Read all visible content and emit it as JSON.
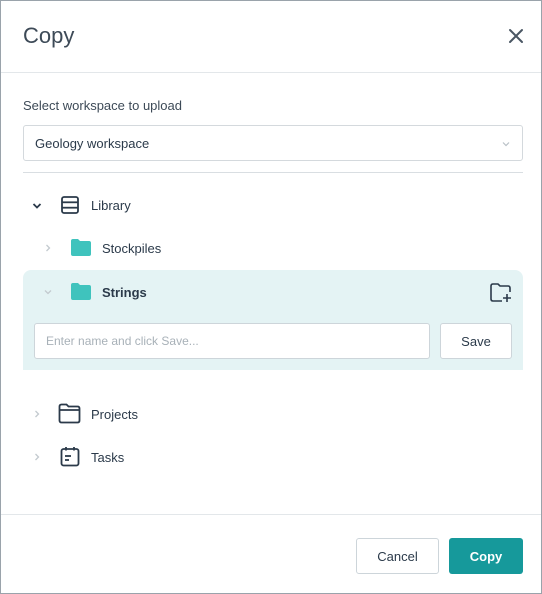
{
  "dialog": {
    "title": "Copy",
    "close_icon": "close-icon"
  },
  "workspace": {
    "label": "Select workspace to upload",
    "selected": "Geology workspace",
    "chevron_icon": "chevron-down-icon"
  },
  "tree": {
    "library": {
      "label": "Library",
      "icon": "library-icon",
      "expanded": true
    },
    "stockpiles": {
      "label": "Stockpiles",
      "icon": "folder-icon",
      "expanded": false
    },
    "strings": {
      "label": "Strings",
      "icon": "folder-icon",
      "selected": true
    },
    "projects": {
      "label": "Projects",
      "icon": "folder-outline-icon",
      "expanded": false
    },
    "tasks": {
      "label": "Tasks",
      "icon": "tasks-icon",
      "expanded": false
    }
  },
  "new_folder": {
    "placeholder": "Enter name and click Save...",
    "value": "",
    "save_label": "Save",
    "add_icon": "add-folder-icon"
  },
  "footer": {
    "cancel_label": "Cancel",
    "copy_label": "Copy"
  },
  "colors": {
    "accent": "#16999b",
    "folder": "#3fc3bd",
    "selected_bg": "#e4f3f4",
    "text": "#2b3a4a"
  }
}
